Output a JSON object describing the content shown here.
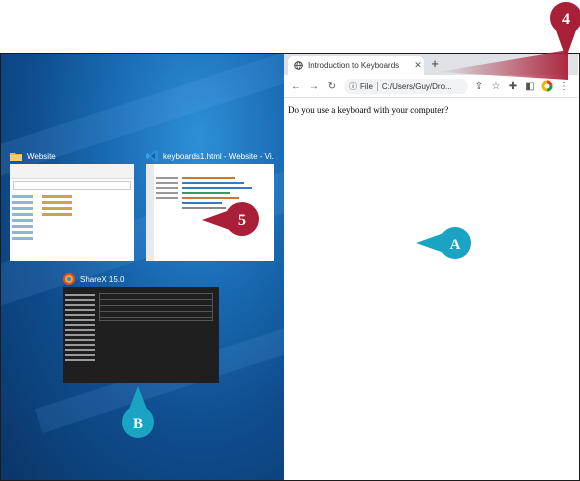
{
  "snaps": {
    "explorer": {
      "title": "Website"
    },
    "vscode": {
      "title": "keyboards1.html - Website - Vi..."
    },
    "sharex": {
      "title": "ShareX 15.0"
    }
  },
  "browser": {
    "tab_title": "Introduction to Keyboards",
    "new_tab": "+",
    "address_scheme": "File",
    "address_path": "C:/Users/Guy/Dro...",
    "page_text": "Do you use a keyboard with your computer?"
  },
  "callouts": {
    "step4": "4",
    "step5": "5",
    "a": "A",
    "b": "B"
  },
  "colors": {
    "step_callout": "#a91f37",
    "letter_callout": "#1aa3c3",
    "desktop": "#0f4d8e"
  },
  "icons": [
    "folder-icon",
    "vscode-icon",
    "sharex-icon",
    "globe-icon",
    "close-icon",
    "back-icon",
    "forward-icon",
    "reload-icon",
    "info-icon",
    "share-icon",
    "star-icon",
    "extensions-icon",
    "sidebar-icon",
    "profile-icon",
    "menu-icon"
  ]
}
